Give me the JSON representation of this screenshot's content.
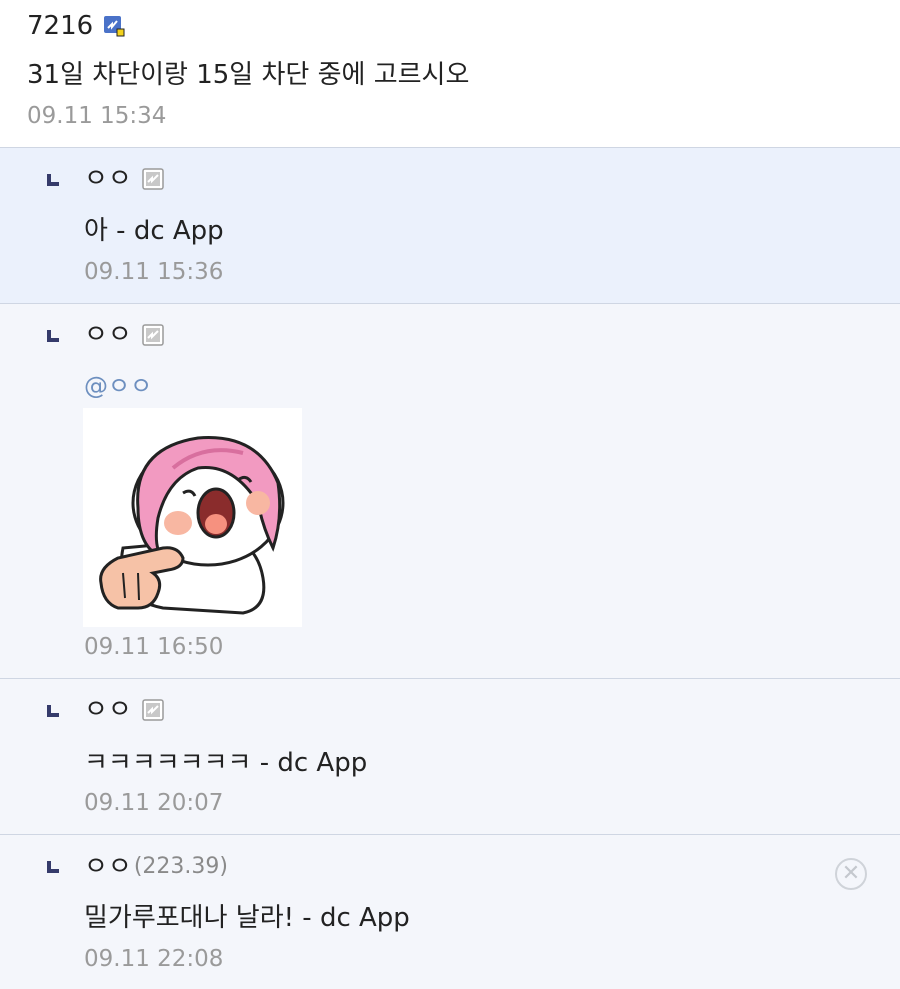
{
  "post": {
    "nickname": "7216",
    "body": "31일 차단이랑 15일 차단 중에 고르시오",
    "date": "09.11 15:34"
  },
  "replies": [
    {
      "nickname": "ㅇㅇ",
      "body": "아 - dc App",
      "date": "09.11 15:36",
      "icon": "gallog-fixed-icon"
    },
    {
      "nickname": "ㅇㅇ",
      "mention": "@ㅇㅇ",
      "sticker": "crying-pink-hair-character-sticker",
      "date": "09.11 16:50",
      "icon": "gallog-fixed-icon"
    },
    {
      "nickname": "ㅇㅇ",
      "body": "ㅋㅋㅋㅋㅋㅋㅋ - dc App",
      "date": "09.11 20:07",
      "icon": "gallog-fixed-icon"
    },
    {
      "nickname": "ㅇㅇ",
      "ip": "(223.39)",
      "body": "밀가루포대나 날라! - dc App",
      "date": "09.11 22:08",
      "delete_icon": "close-circle-icon"
    }
  ],
  "colors": {
    "highlight_bg": "#ebf1fc",
    "reply_bg": "#f4f6fb",
    "date": "#9a9a9a",
    "mention": "#6d8fbf",
    "reply_marker": "#353b6b"
  }
}
